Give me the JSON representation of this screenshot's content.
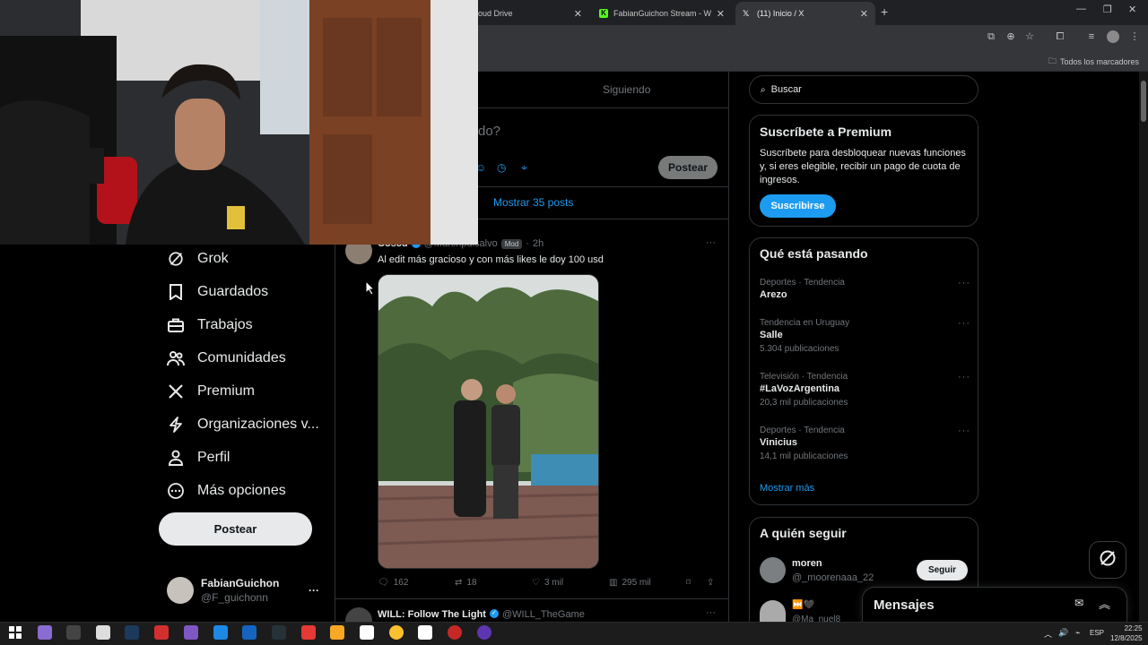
{
  "browser": {
    "tabs": [
      {
        "label": "oud Drive",
        "close": "✕",
        "active": false
      },
      {
        "label": "FabianGuichon Stream - Watch",
        "close": "✕",
        "active": false,
        "favicon_color": "#53fc18"
      },
      {
        "label": "(11) Inicio / X",
        "close": "✕",
        "active": true
      }
    ],
    "new_tab": "+",
    "bookmarks_all": "Todos los marcadores"
  },
  "nav": {
    "items": [
      {
        "label": "Grok",
        "icon": "grok-icon"
      },
      {
        "label": "Guardados",
        "icon": "bookmark-icon"
      },
      {
        "label": "Trabajos",
        "icon": "briefcase-icon"
      },
      {
        "label": "Comunidades",
        "icon": "people-icon"
      },
      {
        "label": "Premium",
        "icon": "x-logo-icon"
      },
      {
        "label": "Organizaciones v...",
        "icon": "lightning-icon"
      },
      {
        "label": "Perfil",
        "icon": "person-icon"
      },
      {
        "label": "Más opciones",
        "icon": "more-circle-icon"
      }
    ],
    "post_button": "Postear",
    "profile": {
      "name": "FabianGuichon",
      "handle": "@F_guichonn",
      "more": "···"
    }
  },
  "feed": {
    "tab_following": "Siguiendo",
    "compose_placeholder": "do?",
    "compose_post_button": "Postear",
    "show_more_posts": "Mostrar 35 posts",
    "tweet": {
      "author": "Coscu",
      "handle": "@Martinpdisalvo",
      "badge": "Mod",
      "separator": "·",
      "time": "2h",
      "text": "Al edit más gracioso y con más likes le doy 100 usd",
      "replies": "162",
      "retweets": "18",
      "likes": "3 mil",
      "views": "295 mil",
      "more": "···"
    },
    "next_tweet": {
      "author": "WILL: Follow The Light",
      "handle": "@WILL_TheGame",
      "more": "···"
    }
  },
  "sidebar": {
    "search_placeholder": "Buscar",
    "premium": {
      "title": "Suscríbete a Premium",
      "body": "Suscríbete para desbloquear nuevas funciones y, si eres elegible, recibir un pago de cuota de ingresos.",
      "button": "Suscribirse"
    },
    "trends": {
      "title": "Qué está pasando",
      "items": [
        {
          "category": "Deportes · Tendencia",
          "name": "Arezo",
          "count": ""
        },
        {
          "category": "Tendencia en Uruguay",
          "name": "Salle",
          "count": "5.304 publicaciones"
        },
        {
          "category": "Televisión · Tendencia",
          "name": "#LaVozArgentina",
          "count": "20,3 mil publicaciones"
        },
        {
          "category": "Deportes · Tendencia",
          "name": "Vinicius",
          "count": "14,1 mil publicaciones"
        }
      ],
      "more_dots": "···",
      "show_more": "Mostrar más"
    },
    "who_to_follow": {
      "title": "A quién seguir",
      "items": [
        {
          "name": "moren",
          "handle": "@_moorenaaa_22",
          "button": "Seguir"
        },
        {
          "name": "⏭️🖤",
          "handle": "@Ma_nuel8"
        }
      ]
    }
  },
  "messages": {
    "title": "Mensajes"
  },
  "taskbar": {
    "lang": "ESP",
    "time": "22:25",
    "date": "12/8/2025"
  },
  "colors": {
    "accent": "#1d9bf0",
    "border": "#2f3336",
    "muted": "#71767b",
    "text": "#e7e9ea"
  }
}
